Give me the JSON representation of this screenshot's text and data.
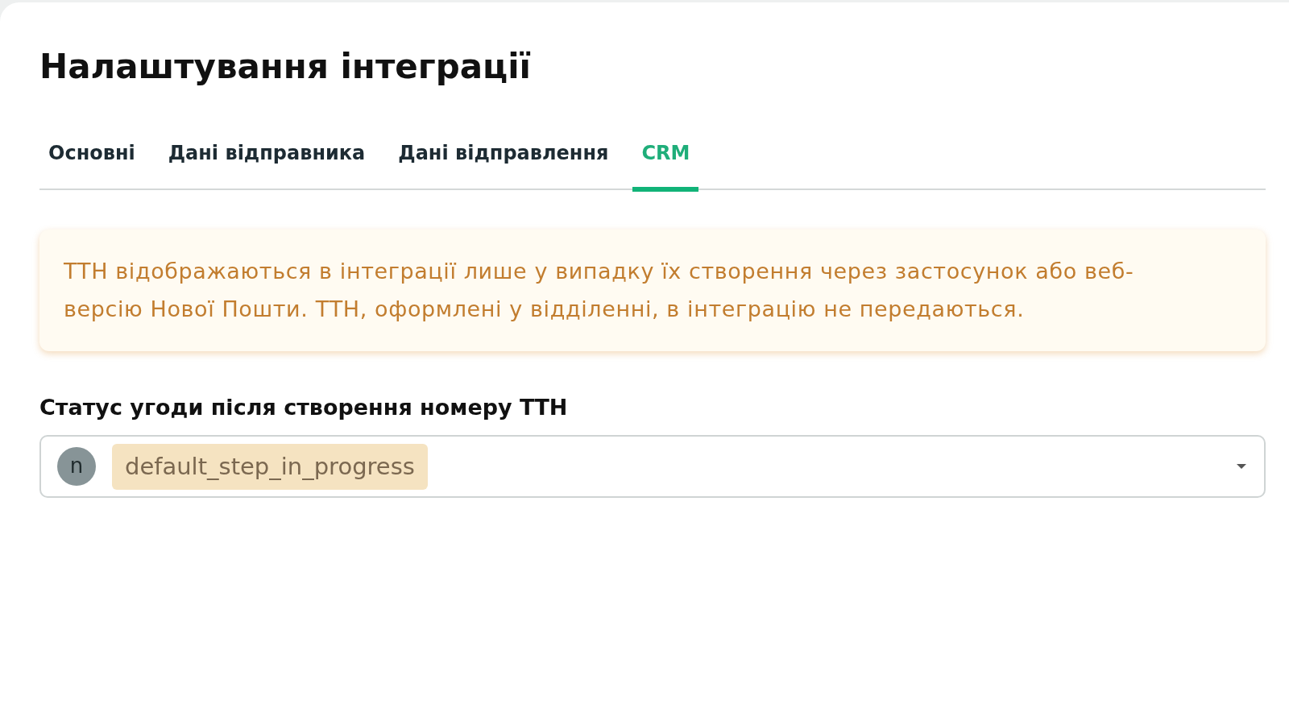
{
  "page": {
    "title": "Налаштування інтеграції"
  },
  "tabs": [
    {
      "label": "Основні",
      "selected": false
    },
    {
      "label": "Дані відправника",
      "selected": false
    },
    {
      "label": "Дані відправлення",
      "selected": false
    },
    {
      "label": "CRM",
      "selected": true
    }
  ],
  "notice": {
    "text": "ТТН відображаються в інтеграції лише у випадку їх створення через застосунок або веб-версію Нової Пошти. ТТН, оформлені у відділенні, в інтеграцію не передаються."
  },
  "deal_status_field": {
    "label": "Статус угоди після створення номеру ТТН",
    "avatar_letter": "n",
    "value": "default_step_in_progress"
  }
}
